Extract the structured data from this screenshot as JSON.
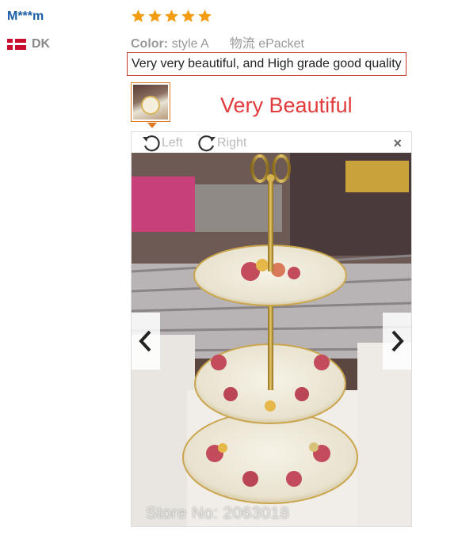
{
  "reviewer": {
    "name": "M***m",
    "country_code": "DK",
    "flag_icon": "denmark-flag-icon"
  },
  "rating": {
    "stars": 5,
    "star_color": "#f39c12"
  },
  "product": {
    "color_label": "Color:",
    "color_value": "style A",
    "shipping_label": "物流",
    "shipping_value": "ePacket"
  },
  "review": {
    "text": "Very very beautiful, and High grade good quality",
    "border_color": "#c0392b"
  },
  "photo": {
    "caption": "Very Beautiful",
    "rotate_left_label": "Left",
    "rotate_right_label": "Right",
    "watermark": "Store No: 2063018"
  }
}
